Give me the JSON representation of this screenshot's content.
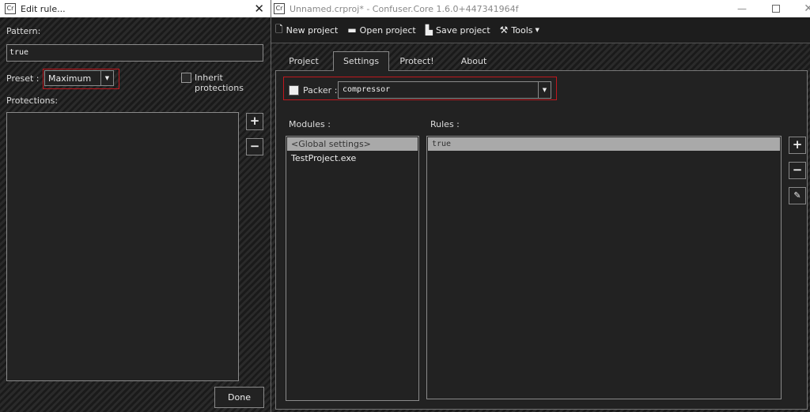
{
  "edit_rule": {
    "title": "Edit rule...",
    "pattern_label": "Pattern:",
    "pattern_value": "true",
    "preset_label": "Preset :",
    "preset_value": "Maximum",
    "inherit_label": "Inherit protections",
    "inherit_checked": false,
    "protections_label": "Protections:",
    "protections": [],
    "add_symbol": "+",
    "remove_symbol": "−",
    "done_label": "Done"
  },
  "main": {
    "title": "Unnamed.crproj* - Confuser.Core 1.6.0+447341964f",
    "toolbar": [
      {
        "label": "New project",
        "icon": "new-file-icon"
      },
      {
        "label": "Open project",
        "icon": "folder-open-icon"
      },
      {
        "label": "Save project",
        "icon": "save-icon"
      },
      {
        "label": "Tools",
        "icon": "tools-icon"
      }
    ],
    "tabs": [
      {
        "label": "Project"
      },
      {
        "label": "Settings",
        "selected": true
      },
      {
        "label": "Protect!"
      },
      {
        "label": "About"
      }
    ],
    "packer_label": "Packer :",
    "packer_checked": false,
    "packer_value": "compressor",
    "modules_label": "Modules :",
    "modules": [
      "<Global settings>",
      "TestProject.exe"
    ],
    "rules_label": "Rules :",
    "rules": [
      "true"
    ],
    "add_symbol": "+",
    "remove_symbol": "−"
  },
  "colors": {
    "highlight": "#c0181e",
    "selection": "#a9a9a9",
    "background": "#222222"
  }
}
